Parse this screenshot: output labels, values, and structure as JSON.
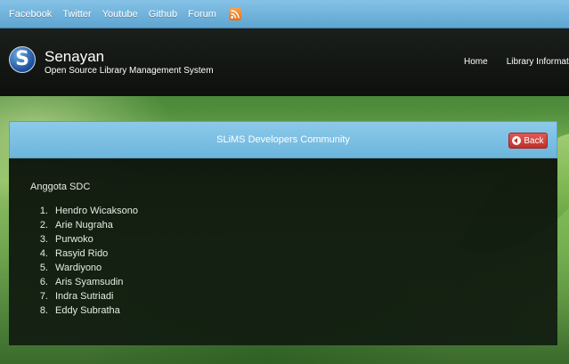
{
  "topbar": {
    "links": [
      "Facebook",
      "Twitter",
      "Youtube",
      "Github",
      "Forum"
    ],
    "rss_icon": "rss-icon"
  },
  "header": {
    "title": "Senayan",
    "subtitle": "Open Source Library Management System",
    "logo_icon": "slims-logo-icon",
    "nav": [
      "Home",
      "Library Information"
    ]
  },
  "panel": {
    "title": "SLiMS Developers Community",
    "back_label": "Back",
    "section_title": "Anggota SDC",
    "members": [
      {
        "num": "1.",
        "name": "Hendro Wicaksono"
      },
      {
        "num": "2.",
        "name": "Arie Nugraha"
      },
      {
        "num": "3.",
        "name": "Purwoko"
      },
      {
        "num": "4.",
        "name": "Rasyid Rido"
      },
      {
        "num": "5.",
        "name": "Wardiyono"
      },
      {
        "num": "6.",
        "name": "Aris Syamsudin"
      },
      {
        "num": "7.",
        "name": "Indra Sutriadi"
      },
      {
        "num": "8.",
        "name": "Eddy Subratha"
      }
    ]
  },
  "colors": {
    "topbar": "#6db5dc",
    "header": "#141814",
    "back_button": "#c0302b"
  }
}
